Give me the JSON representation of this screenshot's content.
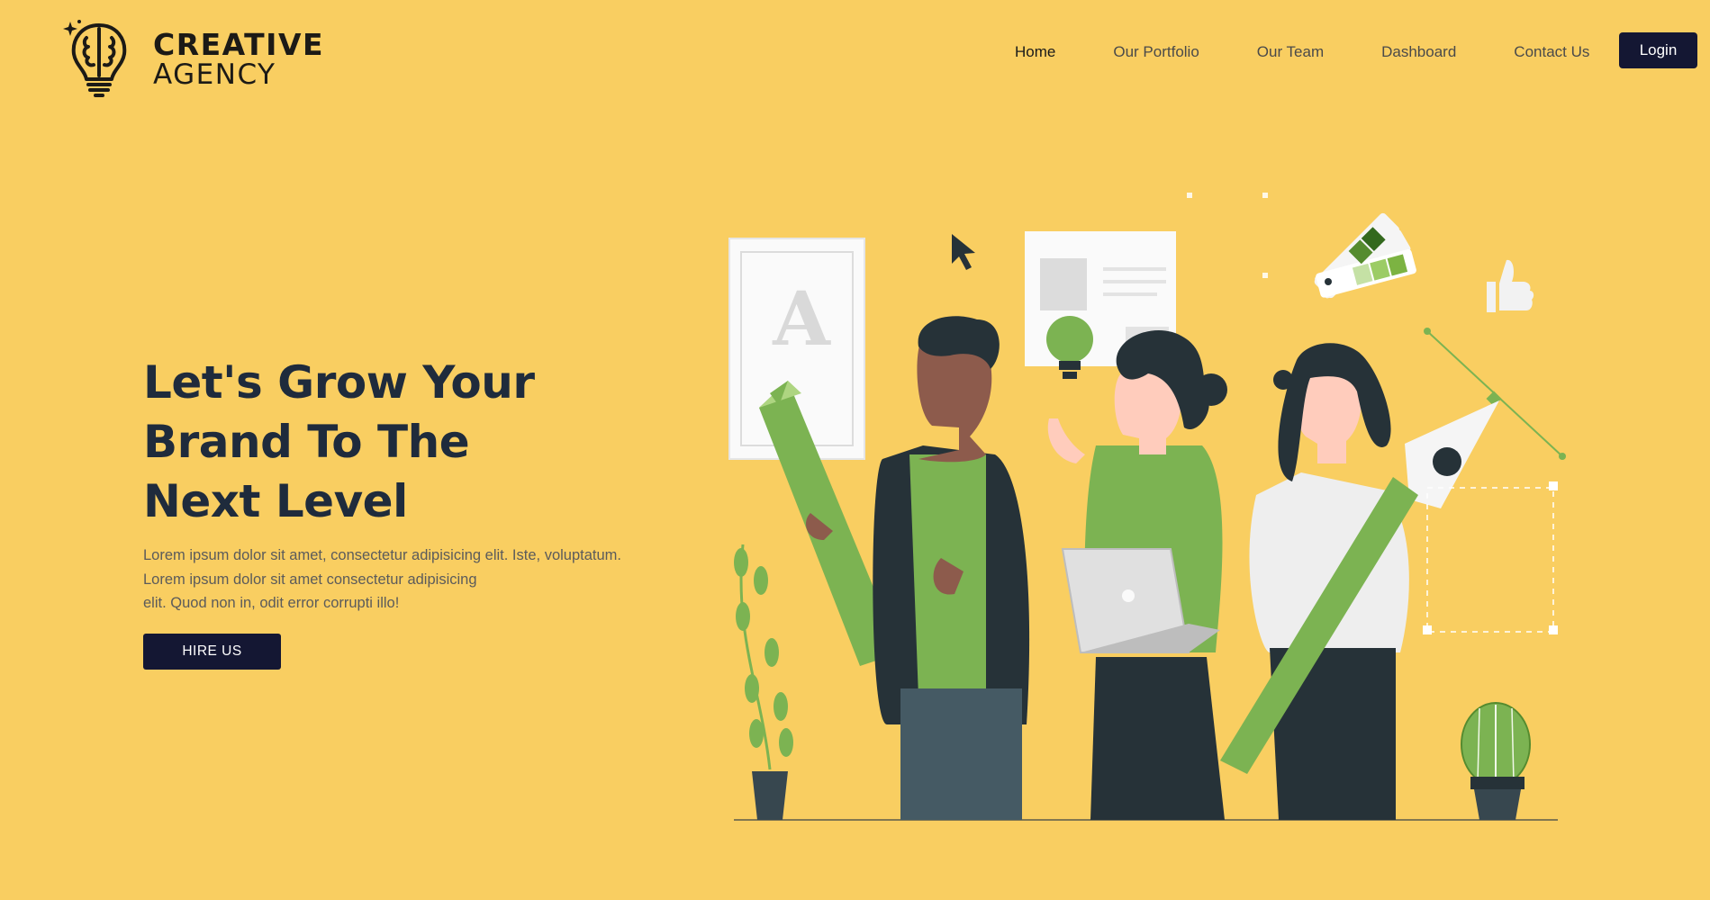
{
  "brand": {
    "line1": "CREATIVE",
    "line2": "AGENCY"
  },
  "nav": {
    "items": [
      "Home",
      "Our Portfolio",
      "Our Team",
      "Dashboard",
      "Contact Us"
    ],
    "active": "Home",
    "login_label": "Login"
  },
  "hero": {
    "title_lines": [
      "Let's Grow Your",
      "Brand To The",
      "Next Level"
    ],
    "description_lines": [
      "Lorem ipsum dolor sit amet, consectetur adipisicing elit. Iste, voluptatum.",
      "Lorem ipsum dolor sit amet consectetur adipisicing",
      "elit. Quod non in, odit error corrupti illo!"
    ],
    "cta_label": "HIRE US"
  },
  "colors": {
    "background": "#F9CE61",
    "dark_navy": "#141733",
    "heading": "#1f2b3c",
    "illustration_green": "#7CB352",
    "illustration_dark": "#263238"
  },
  "icons": [
    "brain-bulb-logo-icon",
    "letter-a-frame-icon",
    "cursor-arrow-icon",
    "lightbulb-icon",
    "color-swatch-fan-icon",
    "thumbs-up-icon",
    "pen-tool-icon",
    "laptop-icon",
    "plant-icon",
    "cactus-icon"
  ]
}
